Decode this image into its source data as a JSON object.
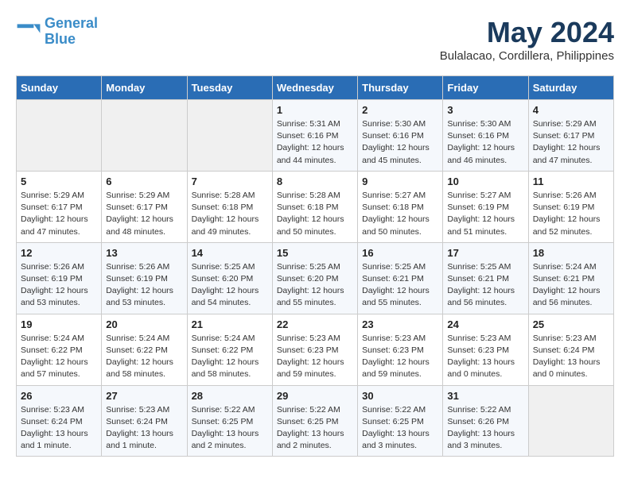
{
  "header": {
    "logo": {
      "line1": "General",
      "line2": "Blue"
    },
    "title": "May 2024",
    "location": "Bulalacao, Cordillera, Philippines"
  },
  "weekdays": [
    "Sunday",
    "Monday",
    "Tuesday",
    "Wednesday",
    "Thursday",
    "Friday",
    "Saturday"
  ],
  "weeks": [
    [
      {
        "day": "",
        "info": ""
      },
      {
        "day": "",
        "info": ""
      },
      {
        "day": "",
        "info": ""
      },
      {
        "day": "1",
        "info": "Sunrise: 5:31 AM\nSunset: 6:16 PM\nDaylight: 12 hours\nand 44 minutes."
      },
      {
        "day": "2",
        "info": "Sunrise: 5:30 AM\nSunset: 6:16 PM\nDaylight: 12 hours\nand 45 minutes."
      },
      {
        "day": "3",
        "info": "Sunrise: 5:30 AM\nSunset: 6:16 PM\nDaylight: 12 hours\nand 46 minutes."
      },
      {
        "day": "4",
        "info": "Sunrise: 5:29 AM\nSunset: 6:17 PM\nDaylight: 12 hours\nand 47 minutes."
      }
    ],
    [
      {
        "day": "5",
        "info": "Sunrise: 5:29 AM\nSunset: 6:17 PM\nDaylight: 12 hours\nand 47 minutes."
      },
      {
        "day": "6",
        "info": "Sunrise: 5:29 AM\nSunset: 6:17 PM\nDaylight: 12 hours\nand 48 minutes."
      },
      {
        "day": "7",
        "info": "Sunrise: 5:28 AM\nSunset: 6:18 PM\nDaylight: 12 hours\nand 49 minutes."
      },
      {
        "day": "8",
        "info": "Sunrise: 5:28 AM\nSunset: 6:18 PM\nDaylight: 12 hours\nand 50 minutes."
      },
      {
        "day": "9",
        "info": "Sunrise: 5:27 AM\nSunset: 6:18 PM\nDaylight: 12 hours\nand 50 minutes."
      },
      {
        "day": "10",
        "info": "Sunrise: 5:27 AM\nSunset: 6:19 PM\nDaylight: 12 hours\nand 51 minutes."
      },
      {
        "day": "11",
        "info": "Sunrise: 5:26 AM\nSunset: 6:19 PM\nDaylight: 12 hours\nand 52 minutes."
      }
    ],
    [
      {
        "day": "12",
        "info": "Sunrise: 5:26 AM\nSunset: 6:19 PM\nDaylight: 12 hours\nand 53 minutes."
      },
      {
        "day": "13",
        "info": "Sunrise: 5:26 AM\nSunset: 6:19 PM\nDaylight: 12 hours\nand 53 minutes."
      },
      {
        "day": "14",
        "info": "Sunrise: 5:25 AM\nSunset: 6:20 PM\nDaylight: 12 hours\nand 54 minutes."
      },
      {
        "day": "15",
        "info": "Sunrise: 5:25 AM\nSunset: 6:20 PM\nDaylight: 12 hours\nand 55 minutes."
      },
      {
        "day": "16",
        "info": "Sunrise: 5:25 AM\nSunset: 6:21 PM\nDaylight: 12 hours\nand 55 minutes."
      },
      {
        "day": "17",
        "info": "Sunrise: 5:25 AM\nSunset: 6:21 PM\nDaylight: 12 hours\nand 56 minutes."
      },
      {
        "day": "18",
        "info": "Sunrise: 5:24 AM\nSunset: 6:21 PM\nDaylight: 12 hours\nand 56 minutes."
      }
    ],
    [
      {
        "day": "19",
        "info": "Sunrise: 5:24 AM\nSunset: 6:22 PM\nDaylight: 12 hours\nand 57 minutes."
      },
      {
        "day": "20",
        "info": "Sunrise: 5:24 AM\nSunset: 6:22 PM\nDaylight: 12 hours\nand 58 minutes."
      },
      {
        "day": "21",
        "info": "Sunrise: 5:24 AM\nSunset: 6:22 PM\nDaylight: 12 hours\nand 58 minutes."
      },
      {
        "day": "22",
        "info": "Sunrise: 5:23 AM\nSunset: 6:23 PM\nDaylight: 12 hours\nand 59 minutes."
      },
      {
        "day": "23",
        "info": "Sunrise: 5:23 AM\nSunset: 6:23 PM\nDaylight: 12 hours\nand 59 minutes."
      },
      {
        "day": "24",
        "info": "Sunrise: 5:23 AM\nSunset: 6:23 PM\nDaylight: 13 hours\nand 0 minutes."
      },
      {
        "day": "25",
        "info": "Sunrise: 5:23 AM\nSunset: 6:24 PM\nDaylight: 13 hours\nand 0 minutes."
      }
    ],
    [
      {
        "day": "26",
        "info": "Sunrise: 5:23 AM\nSunset: 6:24 PM\nDaylight: 13 hours\nand 1 minute."
      },
      {
        "day": "27",
        "info": "Sunrise: 5:23 AM\nSunset: 6:24 PM\nDaylight: 13 hours\nand 1 minute."
      },
      {
        "day": "28",
        "info": "Sunrise: 5:22 AM\nSunset: 6:25 PM\nDaylight: 13 hours\nand 2 minutes."
      },
      {
        "day": "29",
        "info": "Sunrise: 5:22 AM\nSunset: 6:25 PM\nDaylight: 13 hours\nand 2 minutes."
      },
      {
        "day": "30",
        "info": "Sunrise: 5:22 AM\nSunset: 6:25 PM\nDaylight: 13 hours\nand 3 minutes."
      },
      {
        "day": "31",
        "info": "Sunrise: 5:22 AM\nSunset: 6:26 PM\nDaylight: 13 hours\nand 3 minutes."
      },
      {
        "day": "",
        "info": ""
      }
    ]
  ]
}
